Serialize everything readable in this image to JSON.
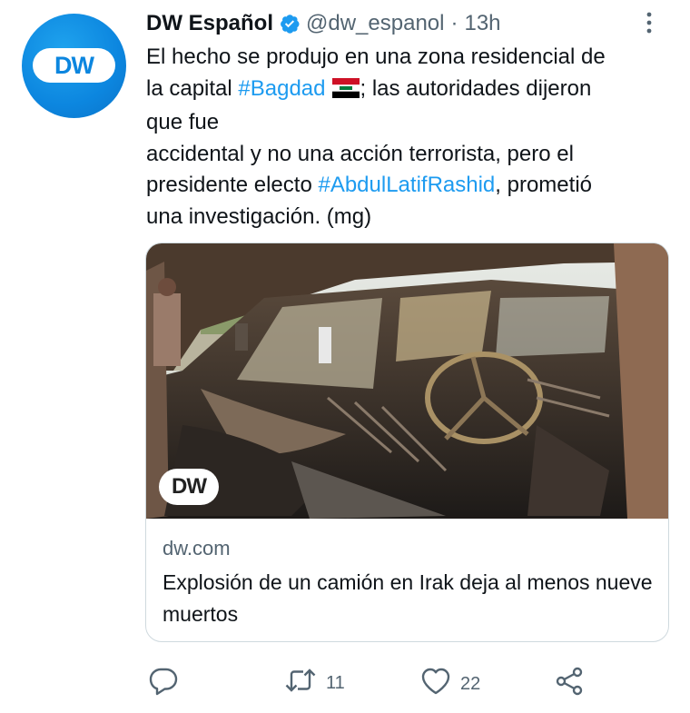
{
  "author": {
    "name": "DW Español",
    "handle": "@dw_espanol",
    "separator": "·",
    "time": "13h",
    "avatar_text": "DW"
  },
  "tweet": {
    "lines": [
      [
        "El hecho se produjo en una zona residencial de"
      ],
      [
        "la capital ",
        "#Bagdad",
        "; las autoridades dijeron"
      ],
      [
        "que fue"
      ],
      [
        "accidental y no una acción terrorista, pero el"
      ],
      [
        "presidente electo ",
        "#AbdulLatifRashid",
        ", prometió"
      ],
      [
        "una investigación. (mg)"
      ]
    ],
    "line2_pre": "la capital ",
    "hashtag1": "#Bagdad",
    "line2_post": "; las autoridades dijeron",
    "line1": "El hecho se produjo en una zona residencial de",
    "line3": "que fue",
    "line4": "accidental y no una acción terrorista, pero el",
    "line5_pre": "presidente electo ",
    "hashtag2": "#AbdulLatifRashid",
    "line5_post": ", prometió",
    "line6": "una investigación. (mg)"
  },
  "card": {
    "watermark": "DW",
    "domain": "dw.com",
    "title": "Explosión de un camión en Irak deja al menos nueve muertos"
  },
  "actions": {
    "retweets": "11",
    "likes": "22"
  },
  "icons": [
    "verified-icon",
    "more-icon",
    "iraq-flag-icon",
    "reply-icon",
    "retweet-icon",
    "like-icon",
    "share-icon"
  ],
  "colors": {
    "brand": "#0c86df",
    "link": "#1d9bf0",
    "muted": "#536471",
    "text": "#0f1419",
    "border": "#cfd9de"
  }
}
